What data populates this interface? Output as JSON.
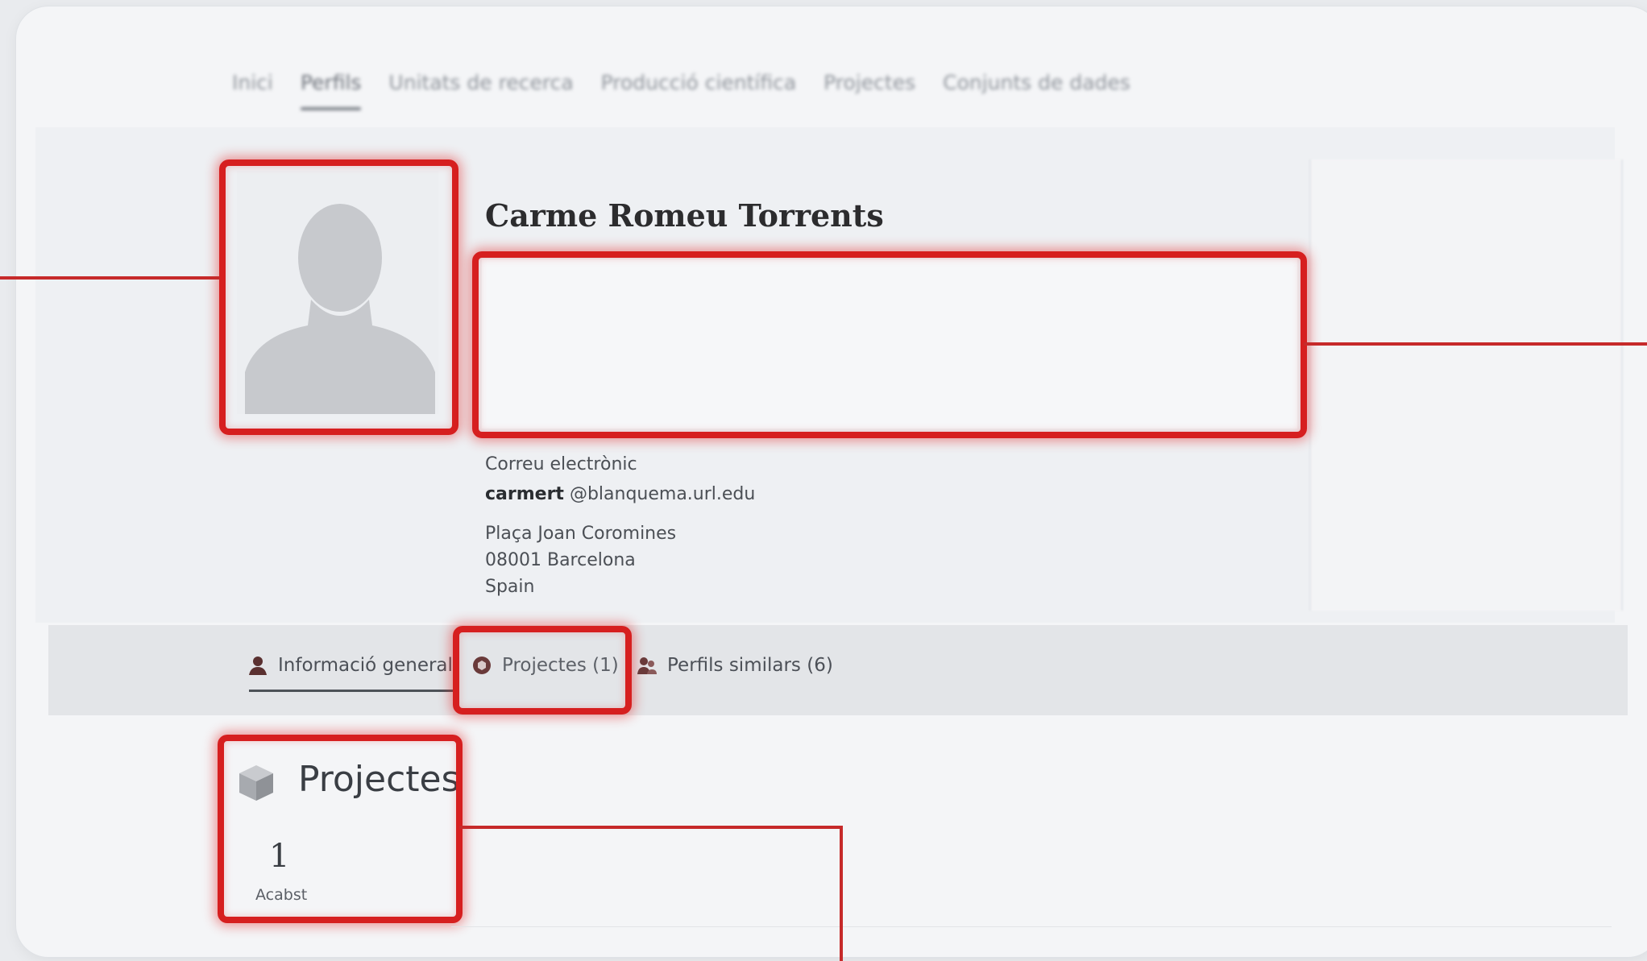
{
  "topnav": {
    "items": [
      {
        "label": "Inici",
        "active": false
      },
      {
        "label": "Perfils",
        "active": true
      },
      {
        "label": "Unitats de recerca",
        "active": false
      },
      {
        "label": "Producció científica",
        "active": false
      },
      {
        "label": "Projectes",
        "active": false
      },
      {
        "label": "Conjunts de dades",
        "active": false
      }
    ]
  },
  "profile": {
    "name": "Carme Romeu Torrents",
    "email_label": "Correu electrònic",
    "email_user": "carmert",
    "email_domain": " @blanquema.url.edu",
    "address_line1": "Plaça Joan Coromines",
    "address_line2": "08001 Barcelona",
    "address_line3": "Spain",
    "avatar_icon": "person-silhouette-icon"
  },
  "tabs": {
    "general": {
      "label": "Informació general",
      "icon": "person-icon"
    },
    "projects": {
      "label": "Projectes (1)",
      "icon": "projects-icon"
    },
    "similar": {
      "label": "Perfils similars (6)",
      "icon": "people-icon"
    }
  },
  "projects_section": {
    "title": "Projectes",
    "icon": "cube-icon",
    "count": "1",
    "status": "Acabst"
  },
  "colors": {
    "highlight": "#d61f1f",
    "callout_line": "#c62a2a"
  }
}
